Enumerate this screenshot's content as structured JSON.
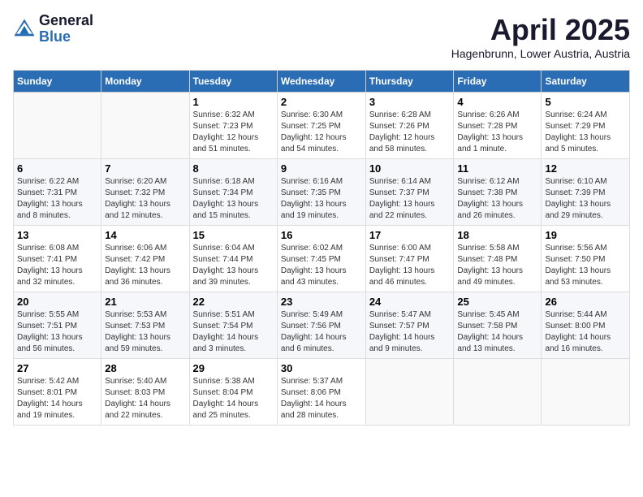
{
  "logo": {
    "general": "General",
    "blue": "Blue"
  },
  "title": "April 2025",
  "subtitle": "Hagenbrunn, Lower Austria, Austria",
  "weekdays": [
    "Sunday",
    "Monday",
    "Tuesday",
    "Wednesday",
    "Thursday",
    "Friday",
    "Saturday"
  ],
  "weeks": [
    [
      {
        "day": "",
        "info": ""
      },
      {
        "day": "",
        "info": ""
      },
      {
        "day": "1",
        "info": "Sunrise: 6:32 AM\nSunset: 7:23 PM\nDaylight: 12 hours and 51 minutes."
      },
      {
        "day": "2",
        "info": "Sunrise: 6:30 AM\nSunset: 7:25 PM\nDaylight: 12 hours and 54 minutes."
      },
      {
        "day": "3",
        "info": "Sunrise: 6:28 AM\nSunset: 7:26 PM\nDaylight: 12 hours and 58 minutes."
      },
      {
        "day": "4",
        "info": "Sunrise: 6:26 AM\nSunset: 7:28 PM\nDaylight: 13 hours and 1 minute."
      },
      {
        "day": "5",
        "info": "Sunrise: 6:24 AM\nSunset: 7:29 PM\nDaylight: 13 hours and 5 minutes."
      }
    ],
    [
      {
        "day": "6",
        "info": "Sunrise: 6:22 AM\nSunset: 7:31 PM\nDaylight: 13 hours and 8 minutes."
      },
      {
        "day": "7",
        "info": "Sunrise: 6:20 AM\nSunset: 7:32 PM\nDaylight: 13 hours and 12 minutes."
      },
      {
        "day": "8",
        "info": "Sunrise: 6:18 AM\nSunset: 7:34 PM\nDaylight: 13 hours and 15 minutes."
      },
      {
        "day": "9",
        "info": "Sunrise: 6:16 AM\nSunset: 7:35 PM\nDaylight: 13 hours and 19 minutes."
      },
      {
        "day": "10",
        "info": "Sunrise: 6:14 AM\nSunset: 7:37 PM\nDaylight: 13 hours and 22 minutes."
      },
      {
        "day": "11",
        "info": "Sunrise: 6:12 AM\nSunset: 7:38 PM\nDaylight: 13 hours and 26 minutes."
      },
      {
        "day": "12",
        "info": "Sunrise: 6:10 AM\nSunset: 7:39 PM\nDaylight: 13 hours and 29 minutes."
      }
    ],
    [
      {
        "day": "13",
        "info": "Sunrise: 6:08 AM\nSunset: 7:41 PM\nDaylight: 13 hours and 32 minutes."
      },
      {
        "day": "14",
        "info": "Sunrise: 6:06 AM\nSunset: 7:42 PM\nDaylight: 13 hours and 36 minutes."
      },
      {
        "day": "15",
        "info": "Sunrise: 6:04 AM\nSunset: 7:44 PM\nDaylight: 13 hours and 39 minutes."
      },
      {
        "day": "16",
        "info": "Sunrise: 6:02 AM\nSunset: 7:45 PM\nDaylight: 13 hours and 43 minutes."
      },
      {
        "day": "17",
        "info": "Sunrise: 6:00 AM\nSunset: 7:47 PM\nDaylight: 13 hours and 46 minutes."
      },
      {
        "day": "18",
        "info": "Sunrise: 5:58 AM\nSunset: 7:48 PM\nDaylight: 13 hours and 49 minutes."
      },
      {
        "day": "19",
        "info": "Sunrise: 5:56 AM\nSunset: 7:50 PM\nDaylight: 13 hours and 53 minutes."
      }
    ],
    [
      {
        "day": "20",
        "info": "Sunrise: 5:55 AM\nSunset: 7:51 PM\nDaylight: 13 hours and 56 minutes."
      },
      {
        "day": "21",
        "info": "Sunrise: 5:53 AM\nSunset: 7:53 PM\nDaylight: 13 hours and 59 minutes."
      },
      {
        "day": "22",
        "info": "Sunrise: 5:51 AM\nSunset: 7:54 PM\nDaylight: 14 hours and 3 minutes."
      },
      {
        "day": "23",
        "info": "Sunrise: 5:49 AM\nSunset: 7:56 PM\nDaylight: 14 hours and 6 minutes."
      },
      {
        "day": "24",
        "info": "Sunrise: 5:47 AM\nSunset: 7:57 PM\nDaylight: 14 hours and 9 minutes."
      },
      {
        "day": "25",
        "info": "Sunrise: 5:45 AM\nSunset: 7:58 PM\nDaylight: 14 hours and 13 minutes."
      },
      {
        "day": "26",
        "info": "Sunrise: 5:44 AM\nSunset: 8:00 PM\nDaylight: 14 hours and 16 minutes."
      }
    ],
    [
      {
        "day": "27",
        "info": "Sunrise: 5:42 AM\nSunset: 8:01 PM\nDaylight: 14 hours and 19 minutes."
      },
      {
        "day": "28",
        "info": "Sunrise: 5:40 AM\nSunset: 8:03 PM\nDaylight: 14 hours and 22 minutes."
      },
      {
        "day": "29",
        "info": "Sunrise: 5:38 AM\nSunset: 8:04 PM\nDaylight: 14 hours and 25 minutes."
      },
      {
        "day": "30",
        "info": "Sunrise: 5:37 AM\nSunset: 8:06 PM\nDaylight: 14 hours and 28 minutes."
      },
      {
        "day": "",
        "info": ""
      },
      {
        "day": "",
        "info": ""
      },
      {
        "day": "",
        "info": ""
      }
    ]
  ]
}
